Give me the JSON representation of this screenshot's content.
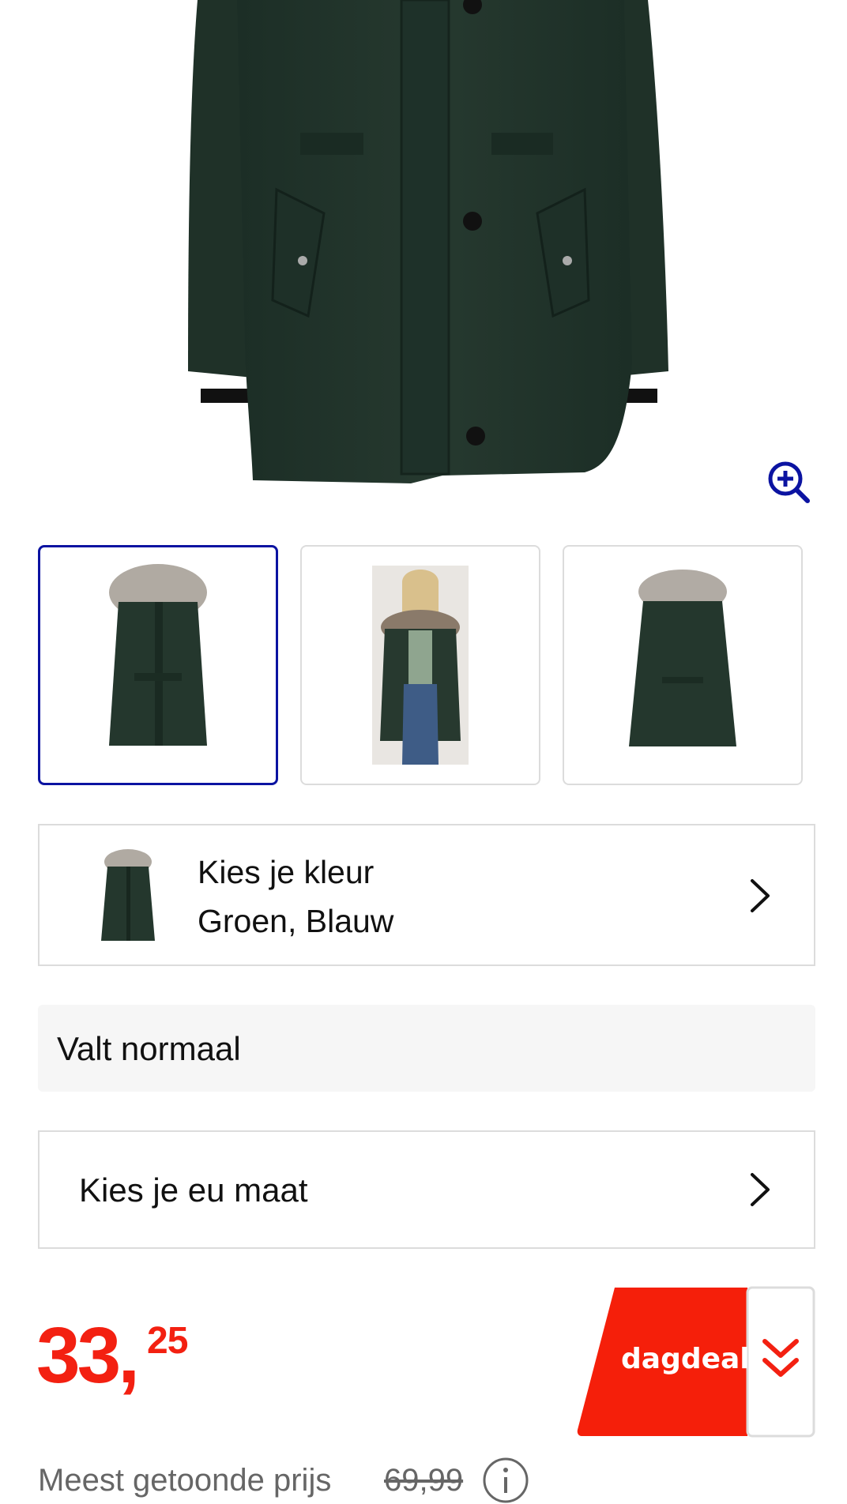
{
  "product": {
    "images": [
      "parka-front",
      "parka-model",
      "parka-back"
    ],
    "selected_image": 0,
    "main_color": "#233a30"
  },
  "icons": {
    "zoom": "zoom-in-icon",
    "chevron": "chevron-right-icon",
    "deal_arrow": "double-chevron-down-icon",
    "info": "info-icon"
  },
  "color_selector": {
    "label": "Kies je kleur",
    "value": "Groen, Blauw"
  },
  "fit": {
    "text": "Valt normaal"
  },
  "size_selector": {
    "label": "Kies je eu maat"
  },
  "price": {
    "whole": "33,",
    "cents": "25",
    "color": "#f32011"
  },
  "deal": {
    "label": "dagdeal",
    "color": "#f51f0a"
  },
  "reference_price": {
    "label": "Meest getoonde prijs",
    "value": "69,99"
  },
  "accent": "#0b13a1"
}
